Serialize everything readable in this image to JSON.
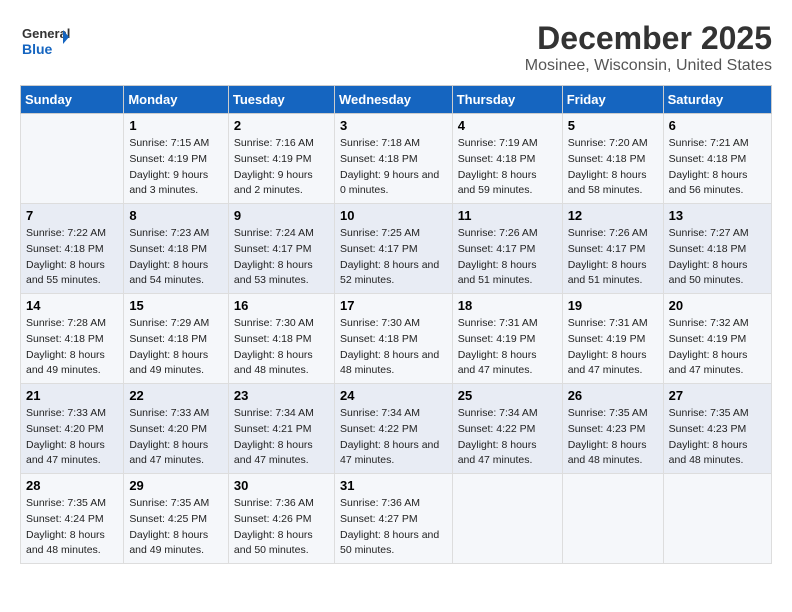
{
  "header": {
    "logo_general": "General",
    "logo_blue": "Blue",
    "title": "December 2025",
    "subtitle": "Mosinee, Wisconsin, United States"
  },
  "days_of_week": [
    "Sunday",
    "Monday",
    "Tuesday",
    "Wednesday",
    "Thursday",
    "Friday",
    "Saturday"
  ],
  "weeks": [
    [
      {
        "day": "",
        "sunrise": "",
        "sunset": "",
        "daylight": ""
      },
      {
        "day": "1",
        "sunrise": "Sunrise: 7:15 AM",
        "sunset": "Sunset: 4:19 PM",
        "daylight": "Daylight: 9 hours and 3 minutes."
      },
      {
        "day": "2",
        "sunrise": "Sunrise: 7:16 AM",
        "sunset": "Sunset: 4:19 PM",
        "daylight": "Daylight: 9 hours and 2 minutes."
      },
      {
        "day": "3",
        "sunrise": "Sunrise: 7:18 AM",
        "sunset": "Sunset: 4:18 PM",
        "daylight": "Daylight: 9 hours and 0 minutes."
      },
      {
        "day": "4",
        "sunrise": "Sunrise: 7:19 AM",
        "sunset": "Sunset: 4:18 PM",
        "daylight": "Daylight: 8 hours and 59 minutes."
      },
      {
        "day": "5",
        "sunrise": "Sunrise: 7:20 AM",
        "sunset": "Sunset: 4:18 PM",
        "daylight": "Daylight: 8 hours and 58 minutes."
      },
      {
        "day": "6",
        "sunrise": "Sunrise: 7:21 AM",
        "sunset": "Sunset: 4:18 PM",
        "daylight": "Daylight: 8 hours and 56 minutes."
      }
    ],
    [
      {
        "day": "7",
        "sunrise": "Sunrise: 7:22 AM",
        "sunset": "Sunset: 4:18 PM",
        "daylight": "Daylight: 8 hours and 55 minutes."
      },
      {
        "day": "8",
        "sunrise": "Sunrise: 7:23 AM",
        "sunset": "Sunset: 4:18 PM",
        "daylight": "Daylight: 8 hours and 54 minutes."
      },
      {
        "day": "9",
        "sunrise": "Sunrise: 7:24 AM",
        "sunset": "Sunset: 4:17 PM",
        "daylight": "Daylight: 8 hours and 53 minutes."
      },
      {
        "day": "10",
        "sunrise": "Sunrise: 7:25 AM",
        "sunset": "Sunset: 4:17 PM",
        "daylight": "Daylight: 8 hours and 52 minutes."
      },
      {
        "day": "11",
        "sunrise": "Sunrise: 7:26 AM",
        "sunset": "Sunset: 4:17 PM",
        "daylight": "Daylight: 8 hours and 51 minutes."
      },
      {
        "day": "12",
        "sunrise": "Sunrise: 7:26 AM",
        "sunset": "Sunset: 4:17 PM",
        "daylight": "Daylight: 8 hours and 51 minutes."
      },
      {
        "day": "13",
        "sunrise": "Sunrise: 7:27 AM",
        "sunset": "Sunset: 4:18 PM",
        "daylight": "Daylight: 8 hours and 50 minutes."
      }
    ],
    [
      {
        "day": "14",
        "sunrise": "Sunrise: 7:28 AM",
        "sunset": "Sunset: 4:18 PM",
        "daylight": "Daylight: 8 hours and 49 minutes."
      },
      {
        "day": "15",
        "sunrise": "Sunrise: 7:29 AM",
        "sunset": "Sunset: 4:18 PM",
        "daylight": "Daylight: 8 hours and 49 minutes."
      },
      {
        "day": "16",
        "sunrise": "Sunrise: 7:30 AM",
        "sunset": "Sunset: 4:18 PM",
        "daylight": "Daylight: 8 hours and 48 minutes."
      },
      {
        "day": "17",
        "sunrise": "Sunrise: 7:30 AM",
        "sunset": "Sunset: 4:18 PM",
        "daylight": "Daylight: 8 hours and 48 minutes."
      },
      {
        "day": "18",
        "sunrise": "Sunrise: 7:31 AM",
        "sunset": "Sunset: 4:19 PM",
        "daylight": "Daylight: 8 hours and 47 minutes."
      },
      {
        "day": "19",
        "sunrise": "Sunrise: 7:31 AM",
        "sunset": "Sunset: 4:19 PM",
        "daylight": "Daylight: 8 hours and 47 minutes."
      },
      {
        "day": "20",
        "sunrise": "Sunrise: 7:32 AM",
        "sunset": "Sunset: 4:19 PM",
        "daylight": "Daylight: 8 hours and 47 minutes."
      }
    ],
    [
      {
        "day": "21",
        "sunrise": "Sunrise: 7:33 AM",
        "sunset": "Sunset: 4:20 PM",
        "daylight": "Daylight: 8 hours and 47 minutes."
      },
      {
        "day": "22",
        "sunrise": "Sunrise: 7:33 AM",
        "sunset": "Sunset: 4:20 PM",
        "daylight": "Daylight: 8 hours and 47 minutes."
      },
      {
        "day": "23",
        "sunrise": "Sunrise: 7:34 AM",
        "sunset": "Sunset: 4:21 PM",
        "daylight": "Daylight: 8 hours and 47 minutes."
      },
      {
        "day": "24",
        "sunrise": "Sunrise: 7:34 AM",
        "sunset": "Sunset: 4:22 PM",
        "daylight": "Daylight: 8 hours and 47 minutes."
      },
      {
        "day": "25",
        "sunrise": "Sunrise: 7:34 AM",
        "sunset": "Sunset: 4:22 PM",
        "daylight": "Daylight: 8 hours and 47 minutes."
      },
      {
        "day": "26",
        "sunrise": "Sunrise: 7:35 AM",
        "sunset": "Sunset: 4:23 PM",
        "daylight": "Daylight: 8 hours and 48 minutes."
      },
      {
        "day": "27",
        "sunrise": "Sunrise: 7:35 AM",
        "sunset": "Sunset: 4:23 PM",
        "daylight": "Daylight: 8 hours and 48 minutes."
      }
    ],
    [
      {
        "day": "28",
        "sunrise": "Sunrise: 7:35 AM",
        "sunset": "Sunset: 4:24 PM",
        "daylight": "Daylight: 8 hours and 48 minutes."
      },
      {
        "day": "29",
        "sunrise": "Sunrise: 7:35 AM",
        "sunset": "Sunset: 4:25 PM",
        "daylight": "Daylight: 8 hours and 49 minutes."
      },
      {
        "day": "30",
        "sunrise": "Sunrise: 7:36 AM",
        "sunset": "Sunset: 4:26 PM",
        "daylight": "Daylight: 8 hours and 50 minutes."
      },
      {
        "day": "31",
        "sunrise": "Sunrise: 7:36 AM",
        "sunset": "Sunset: 4:27 PM",
        "daylight": "Daylight: 8 hours and 50 minutes."
      },
      {
        "day": "",
        "sunrise": "",
        "sunset": "",
        "daylight": ""
      },
      {
        "day": "",
        "sunrise": "",
        "sunset": "",
        "daylight": ""
      },
      {
        "day": "",
        "sunrise": "",
        "sunset": "",
        "daylight": ""
      }
    ]
  ]
}
